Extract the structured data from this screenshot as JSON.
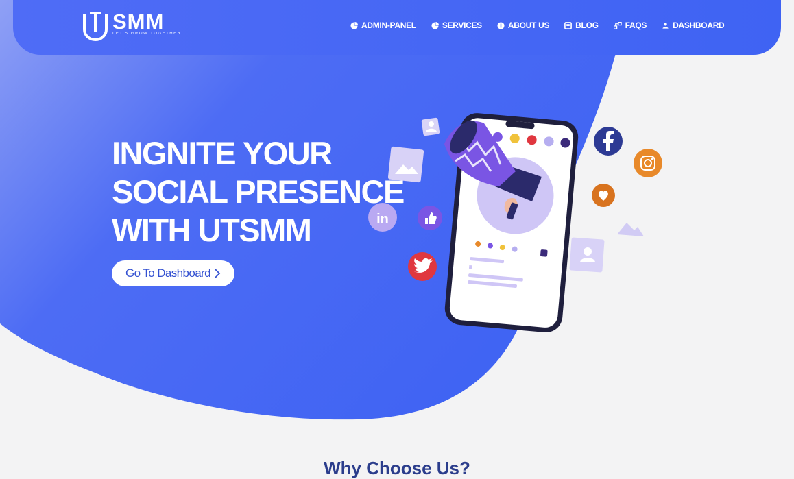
{
  "brand": {
    "name": "SMM",
    "tagline": "LET'S GROW TOGETHER",
    "logo_letter": "U"
  },
  "nav": {
    "items": [
      {
        "label": "ADMIN-PANEL",
        "icon": "pie-chart-icon"
      },
      {
        "label": "SERVICES",
        "icon": "pie-chart-icon"
      },
      {
        "label": "ABOUT US",
        "icon": "info-icon"
      },
      {
        "label": "BLOG",
        "icon": "square-icon"
      },
      {
        "label": "FAQS",
        "icon": "share-icon"
      },
      {
        "label": "DASHBOARD",
        "icon": "user-icon"
      }
    ]
  },
  "hero": {
    "headline_lines": [
      "INGNITE YOUR",
      "SOCIAL PRESENCE",
      "WITH UTSMM"
    ],
    "cta_label": "Go To Dashboard"
  },
  "section": {
    "title": "Why Choose Us?"
  },
  "colors": {
    "accent": "#4366f3",
    "page_bg": "#f3f3f4",
    "button_text": "#3451d1",
    "facebook": "#2d3a94",
    "instagram": "#e8892a",
    "heart": "#d8731f",
    "twitter": "#e0373f",
    "lavender": "#d7d2f6"
  }
}
